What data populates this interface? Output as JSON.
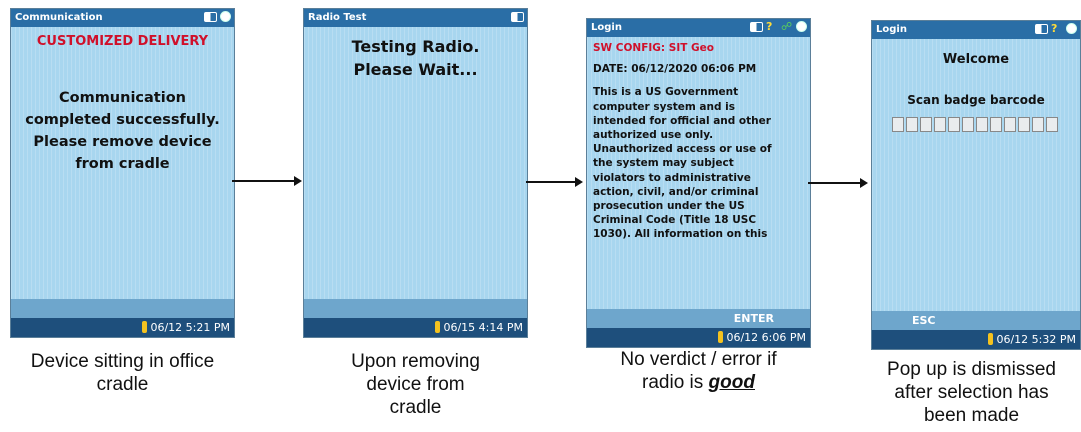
{
  "screens": [
    {
      "title": "Communication",
      "header": "CUSTOMIZED DELIVERY",
      "message_lines": [
        "Communication",
        "completed successfully.",
        "Please remove device",
        "from cradle"
      ],
      "status_time": "06/12 5:21 PM",
      "icons": [
        "battery-icon",
        "power-icon"
      ]
    },
    {
      "title": "Radio Test",
      "message_lines": [
        "Testing Radio.",
        "Please Wait..."
      ],
      "status_time": "06/15 4:14 PM",
      "icons": [
        "battery-icon"
      ]
    },
    {
      "title": "Login",
      "config": "SW CONFIG: SIT Geo",
      "date": "DATE: 06/12/2020 06:06 PM",
      "body_lines": [
        "This is a US Government",
        "computer system and is",
        "intended for official and other",
        "authorized use only.",
        "Unauthorized access or use of",
        "the system may subject",
        "violators to administrative",
        "action, civil, and/or criminal",
        "prosecution under  the US",
        "Criminal Code (Title 18 USC",
        "1030). All information on this"
      ],
      "softkey": "ENTER",
      "status_time": "06/12 6:06 PM",
      "icons": [
        "battery-icon",
        "wifi-icon",
        "link-icon",
        "power-icon"
      ]
    },
    {
      "title": "Login",
      "welcome": "Welcome",
      "prompt": "Scan badge barcode",
      "barcode_cells": 12,
      "softkey": "ESC",
      "status_time": "06/12 5:32 PM",
      "icons": [
        "battery-icon",
        "wifi-icon",
        "power-icon"
      ]
    }
  ],
  "captions": [
    [
      "Device sitting in office",
      "cradle"
    ],
    [
      "Upon removing",
      "device from",
      "cradle"
    ],
    [
      "No verdict / error if",
      "radio is ",
      "good"
    ],
    [
      "Pop up is dismissed",
      "after selection has",
      "been made"
    ]
  ],
  "colors": {
    "screen_bg": "#a8d6ef",
    "title_bar": "#2a6ea6",
    "status_bar": "#1e4f7c",
    "softkey_bar": "#6ea6cc",
    "alert_red": "#d0102a"
  }
}
